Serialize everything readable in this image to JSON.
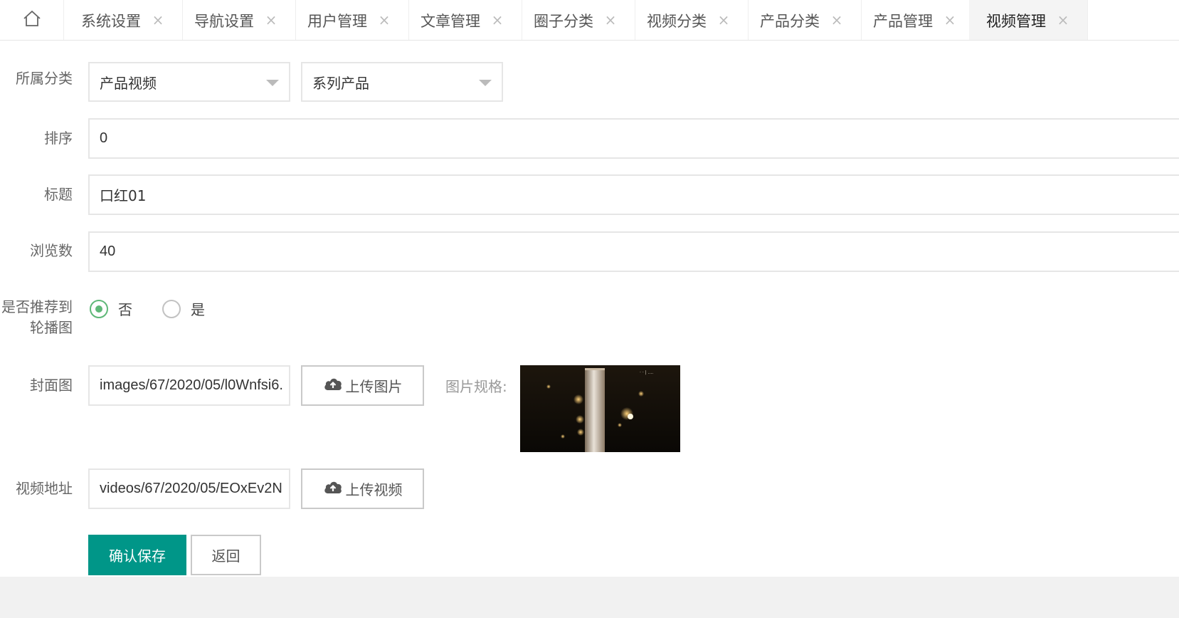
{
  "tabs": {
    "home_icon": "home-icon",
    "close_icon": "close-icon",
    "items": [
      {
        "label": "系统设置"
      },
      {
        "label": "导航设置"
      },
      {
        "label": "用户管理"
      },
      {
        "label": "文章管理"
      },
      {
        "label": "圈子分类"
      },
      {
        "label": "视频分类"
      },
      {
        "label": "产品分类"
      },
      {
        "label": "产品管理"
      },
      {
        "label": "视频管理",
        "active": true
      }
    ]
  },
  "form": {
    "category": {
      "label": "所属分类",
      "select1_value": "产品视频",
      "select2_value": "系列产品"
    },
    "sort": {
      "label": "排序",
      "value": "0"
    },
    "title": {
      "label": "标题",
      "value": "口红01"
    },
    "views": {
      "label": "浏览数",
      "value": "40"
    },
    "recommend": {
      "label_line1": "是否推荐到",
      "label_line2": "轮播图",
      "options": [
        {
          "label": "否",
          "checked": true
        },
        {
          "label": "是",
          "checked": false
        }
      ]
    },
    "cover": {
      "label": "封面图",
      "value": "images/67/2020/05/l0Wnfsi6.",
      "upload_label": "上传图片",
      "upload_icon": "cloud-upload-icon",
      "spec_label": "图片规格:"
    },
    "video": {
      "label": "视频地址",
      "value": "videos/67/2020/05/EOxEv2N",
      "upload_label": "上传视频",
      "upload_icon": "cloud-upload-icon"
    },
    "actions": {
      "save_label": "确认保存",
      "back_label": "返回"
    }
  },
  "colors": {
    "primary": "#009688",
    "radio_checked": "#5fb878",
    "page_bg": "#f1f1f1"
  }
}
